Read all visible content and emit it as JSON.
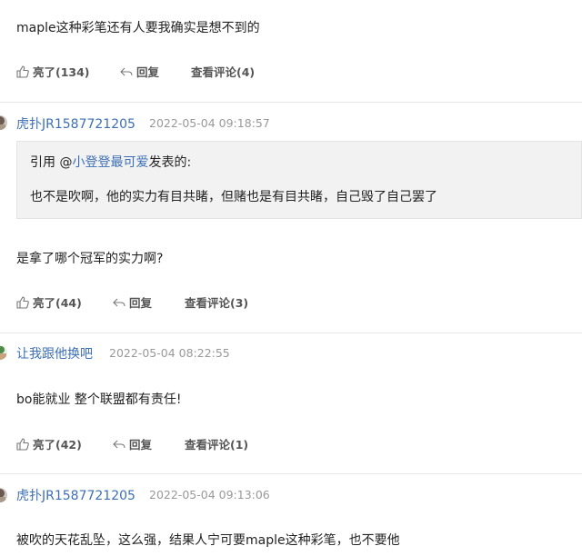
{
  "posts": [
    {
      "content": "maple这种彩笔还有人要我确实是想不到的",
      "actions": {
        "like": "亮了(134)",
        "reply": "回复",
        "view": "查看评论(4)"
      }
    },
    {
      "username": "虎扑JR1587721205",
      "time": "2022-05-04 09:18:57",
      "quote": {
        "prefix": "引用 @",
        "user": "小登登最可爱",
        "suffix": "发表的:",
        "text": "也不是吹啊，他的实力有目共睹，但赌也是有目共睹，自己毁了自己罢了"
      },
      "content": "是拿了哪个冠军的实力啊?",
      "actions": {
        "like": "亮了(44)",
        "reply": "回复",
        "view": "查看评论(3)"
      }
    },
    {
      "username": "让我跟他换吧",
      "time": "2022-05-04 08:22:55",
      "content": "bo能就业  整个联盟都有责任!",
      "actions": {
        "like": "亮了(42)",
        "reply": "回复",
        "view": "查看评论(1)"
      }
    },
    {
      "username": "虎扑JR1587721205",
      "time": "2022-05-04 09:13:06",
      "content": "被吹的天花乱坠，这么强，结果人宁可要maple这种彩笔，也不要他"
    }
  ],
  "colors": {
    "link": "#3d6fb5",
    "meta": "#999999",
    "quote_bg": "#f2f2f2",
    "divider": "#e6e6e6"
  },
  "icons": {
    "like": "thumbs-up-icon",
    "reply": "reply-arrow-icon"
  }
}
